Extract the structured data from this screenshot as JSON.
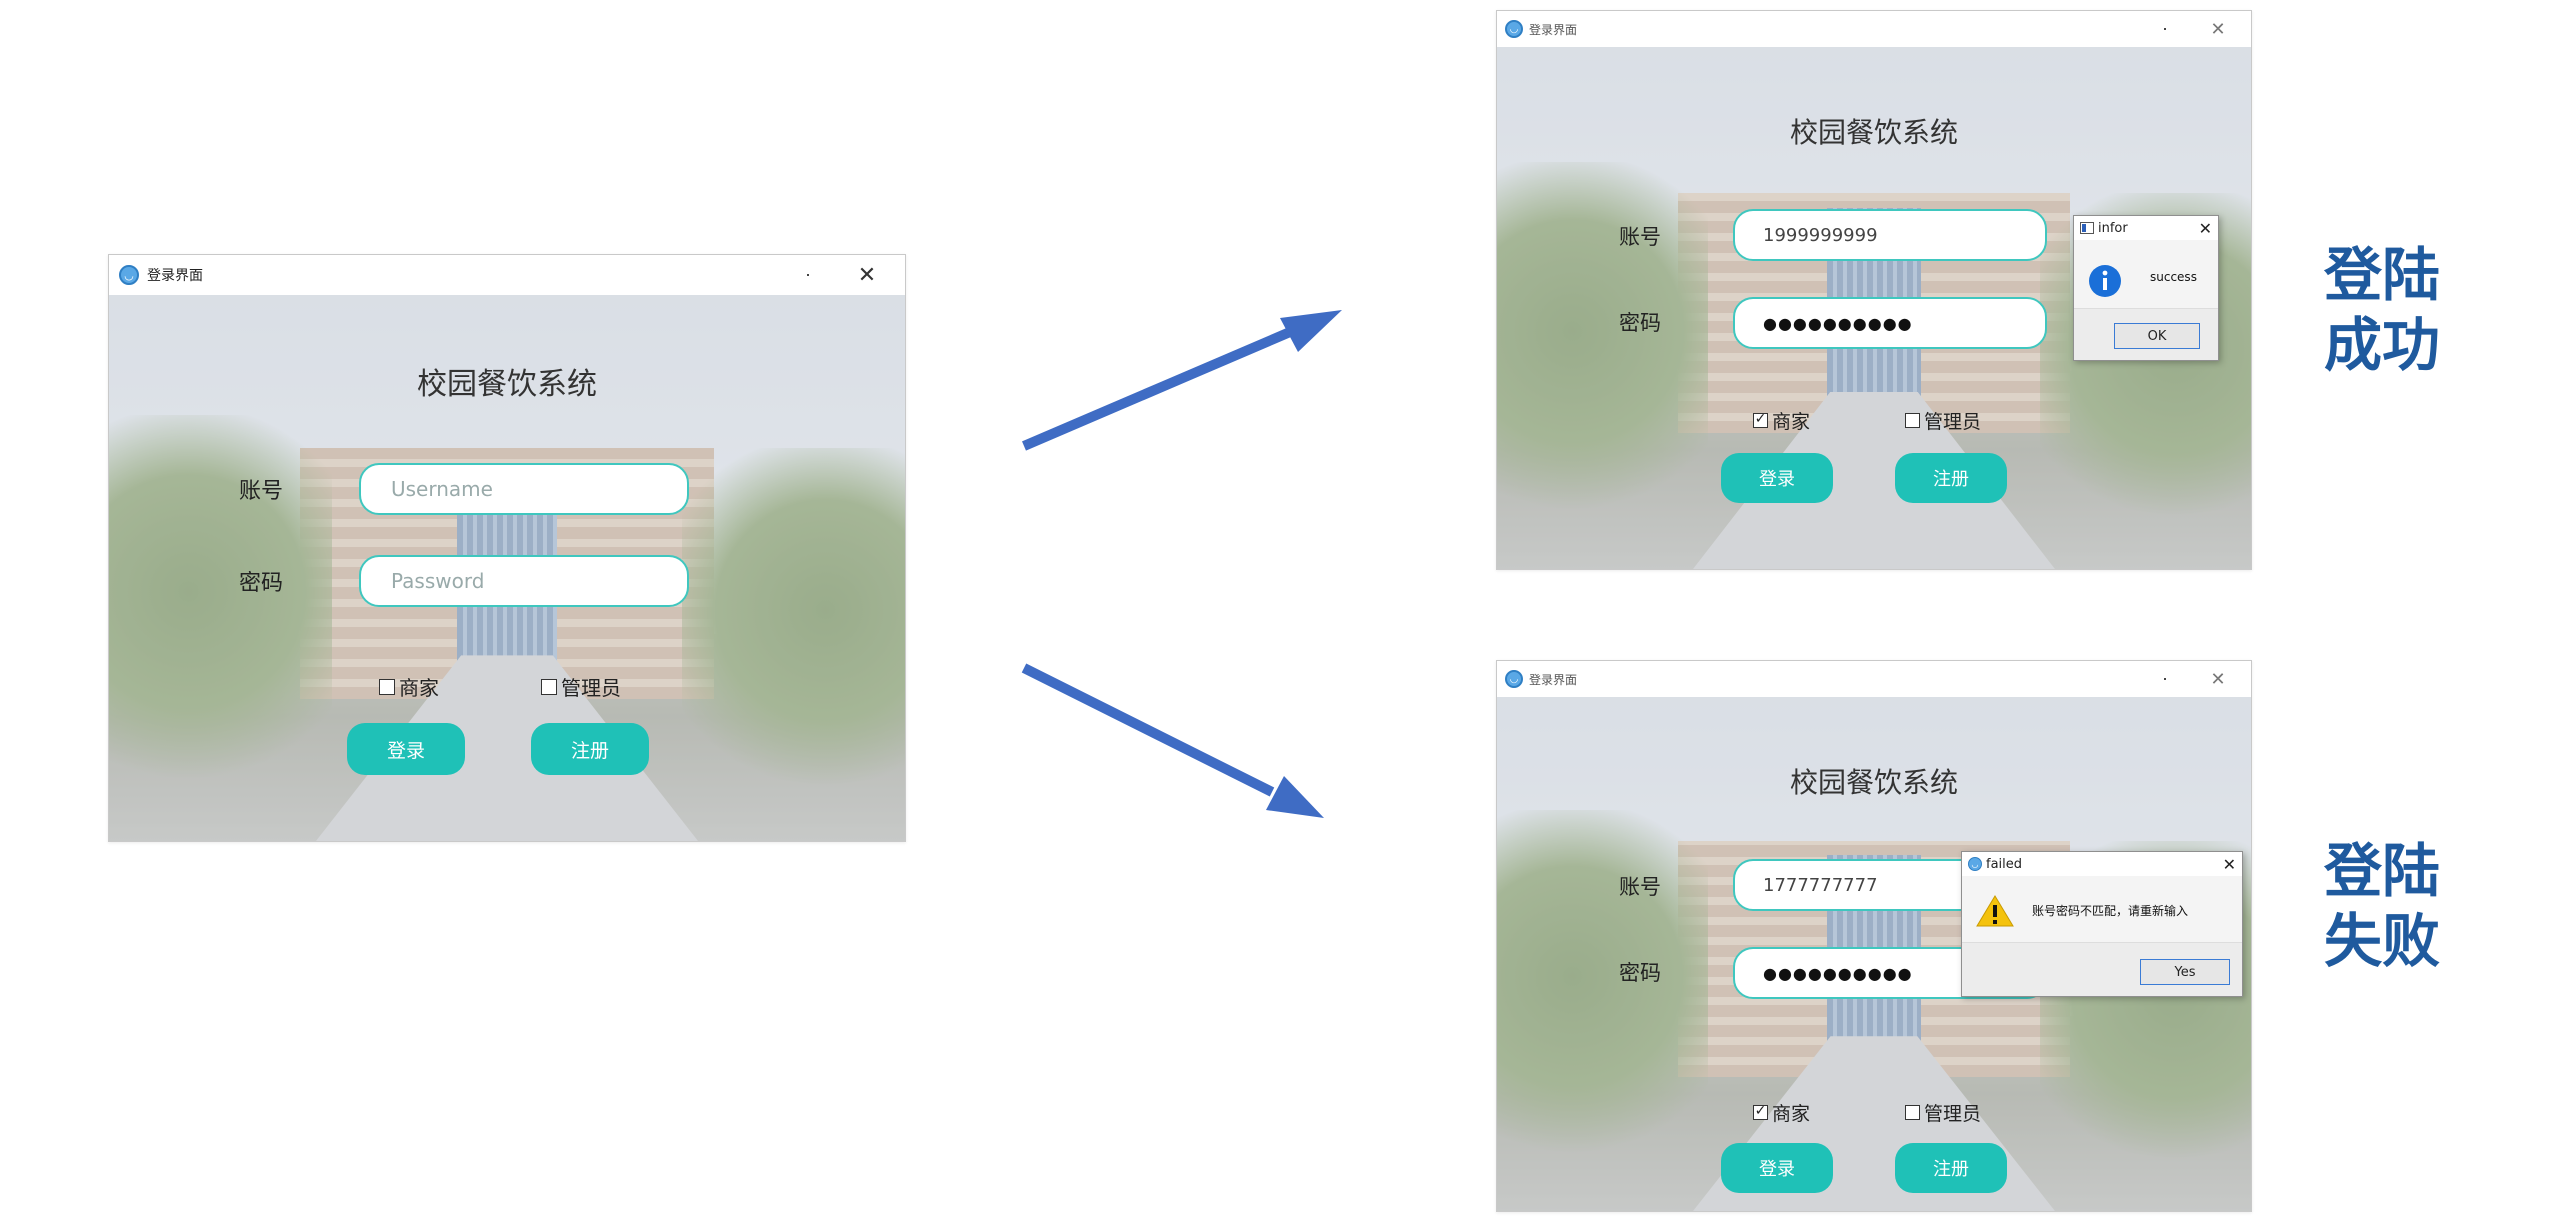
{
  "window": {
    "title": "登录界面"
  },
  "app": {
    "system_title": "校园餐饮系统",
    "account_label": "账号",
    "password_label": "密码",
    "username_placeholder": "Username",
    "password_placeholder": "Password",
    "merchant_label": "商家",
    "admin_label": "管理员",
    "login_button": "登录",
    "register_button": "注册"
  },
  "success_case": {
    "username_value": "1999999999",
    "password_mask": "●●●●●●●●●●",
    "dialog": {
      "title": "infor",
      "message": "success",
      "button": "OK"
    }
  },
  "failure_case": {
    "username_value": "1777777777",
    "password_mask": "●●●●●●●●●●",
    "dialog": {
      "title": "failed",
      "message": "账号密码不匹配，请重新输入",
      "button": "Yes"
    }
  },
  "captions": {
    "success": [
      "登陆",
      "成功"
    ],
    "failure": [
      "登陆",
      "失败"
    ]
  },
  "colors": {
    "accent": "#1fc1b7",
    "field_border": "#3fc7bf",
    "caption": "#1f5a9e",
    "arrow": "#3f6cc4"
  },
  "icons": {
    "info": "info-icon",
    "warning": "warning-icon",
    "app": "app-logo-icon"
  }
}
